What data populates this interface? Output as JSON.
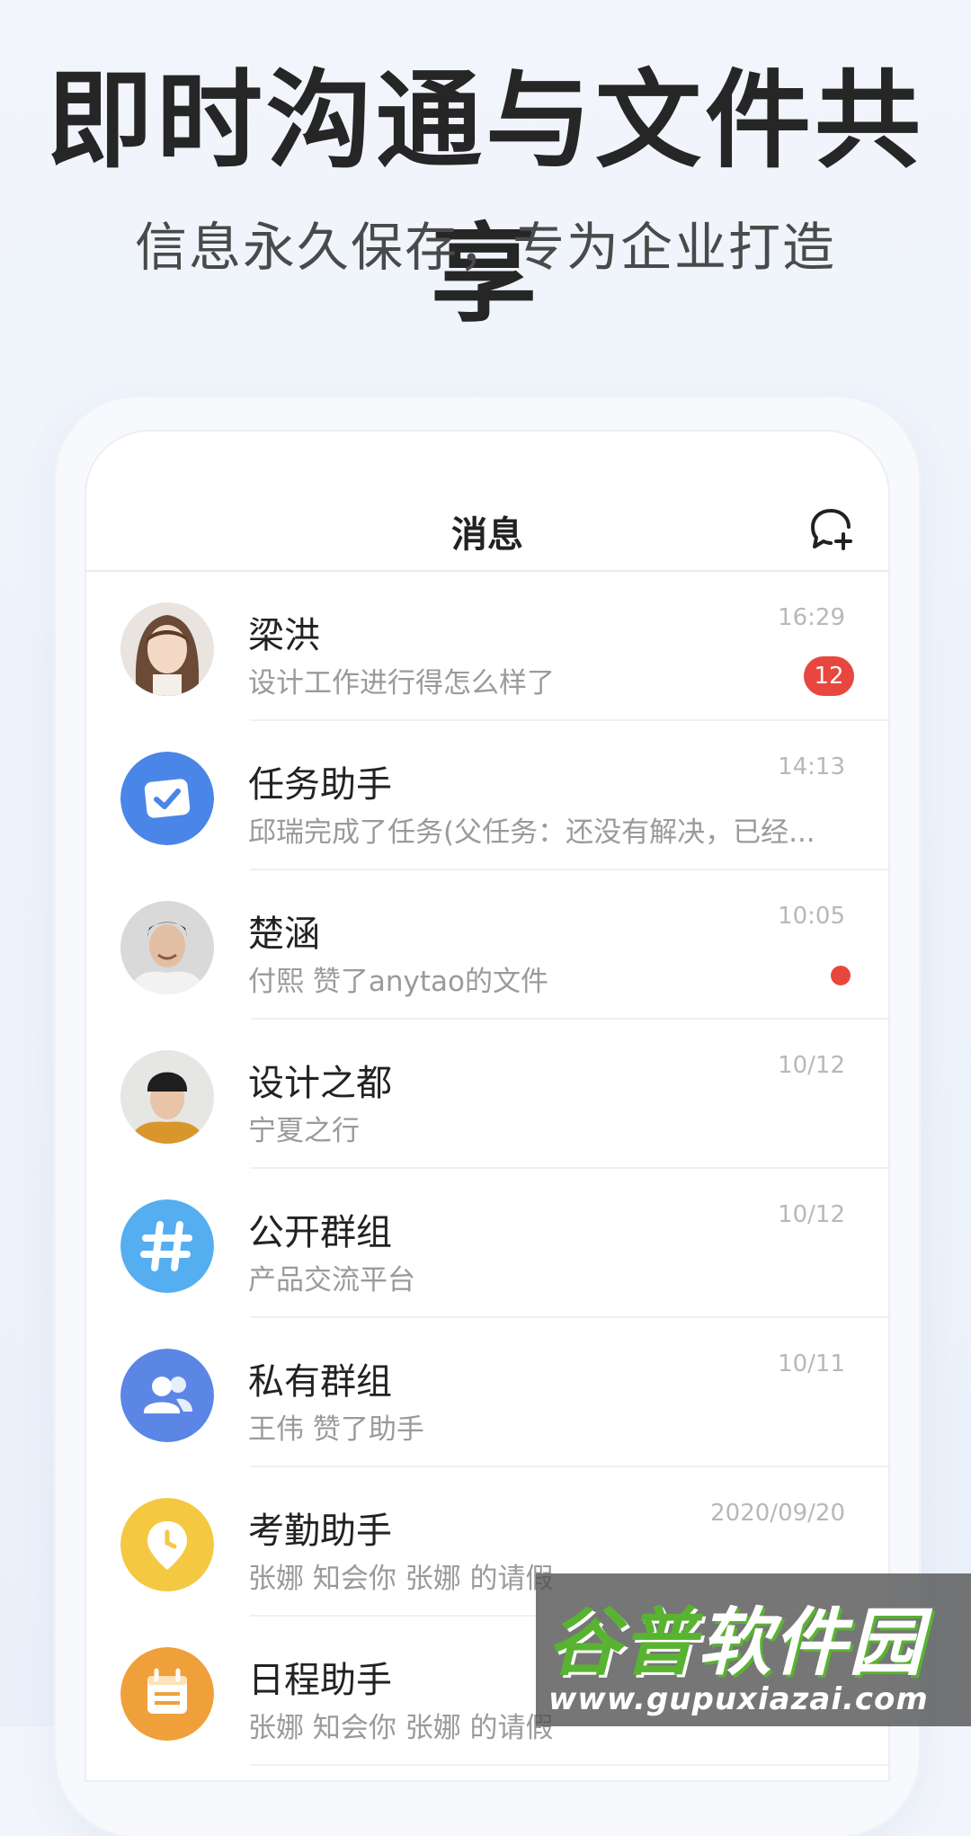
{
  "promo": {
    "headline": "即时沟通与文件共享",
    "subline": "信息永久保存，专为企业打造"
  },
  "app": {
    "nav_title": "消息",
    "compose_icon": "chat-add-icon"
  },
  "messages": [
    {
      "name": "梁洪",
      "preview": "设计工作进行得怎么样了",
      "time": "16:29",
      "badge": "12",
      "avatar": "photo-woman-long-hair"
    },
    {
      "name": "任务助手",
      "preview": "邱瑞完成了任务(父任务：还没有解决，已经...",
      "time": "14:13",
      "avatar": "task-check-icon",
      "color": "#4a86e8"
    },
    {
      "name": "楚涵",
      "preview": "付熙 赞了anytao的文件",
      "time": "10:05",
      "unread_dot": true,
      "avatar": "photo-man-smiling"
    },
    {
      "name": "设计之都",
      "preview": "宁夏之行",
      "time": "10/12",
      "avatar": "photo-man-beanie"
    },
    {
      "name": "公开群组",
      "preview": "产品交流平台",
      "time": "10/12",
      "avatar": "hashtag-icon",
      "color": "#55aef0"
    },
    {
      "name": "私有群组",
      "preview": "王伟 赞了助手",
      "time": "10/11",
      "avatar": "users-icon",
      "color": "#5b86e5"
    },
    {
      "name": "考勤助手",
      "preview": "张娜 知会你 张娜 的请假",
      "time": "2020/09/20",
      "avatar": "clock-pin-icon",
      "color": "#f5c842"
    },
    {
      "name": "日程助手",
      "preview": "张娜 知会你 张娜 的请假",
      "time": "",
      "avatar": "calendar-icon",
      "color": "#f0a03a"
    }
  ],
  "watermark": {
    "brand_green": "谷普",
    "brand_white": "软件园",
    "url": "www.gupuxiazai.com"
  }
}
